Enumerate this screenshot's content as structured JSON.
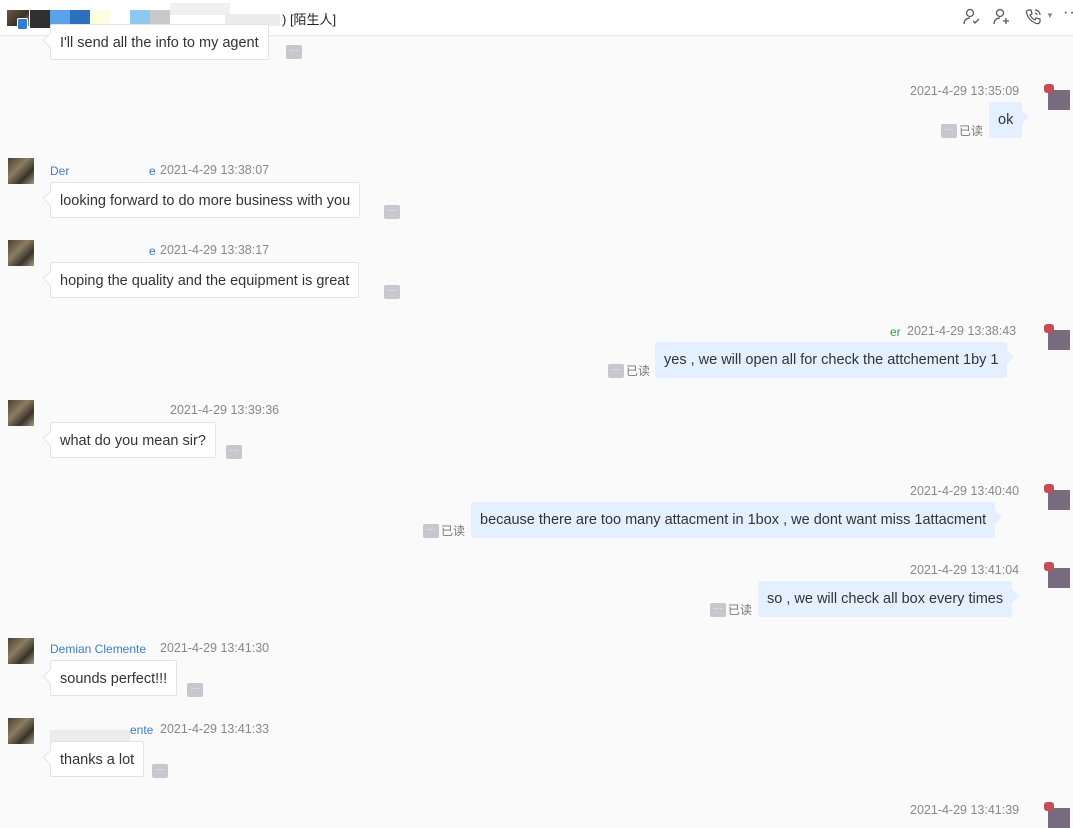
{
  "window": {
    "title": ") [陌生人]",
    "icons": [
      "add-contact-icon",
      "add-member-icon",
      "phone-call-icon",
      "more-icon"
    ],
    "more_label": "··"
  },
  "read_status_label": "已读",
  "dots_label": "···",
  "messages": [
    {
      "direction": "in",
      "text": "I'll send all the info to my agent"
    },
    {
      "direction": "out",
      "timestamp": "2021-4-29 13:35:09",
      "text": "ok",
      "read": "已读"
    },
    {
      "direction": "in",
      "name_fragment": "Der",
      "name_suffix": "e",
      "timestamp": "2021-4-29 13:38:07",
      "text": "looking forward to do more business with you"
    },
    {
      "direction": "in",
      "name_suffix": "e",
      "timestamp": "2021-4-29 13:38:17",
      "text": "hoping the quality and the equipment is great"
    },
    {
      "direction": "out",
      "name_fragment": "er",
      "timestamp": "2021-4-29 13:38:43",
      "text": "yes , we will open all for check the attchement 1by 1",
      "read": "已读"
    },
    {
      "direction": "in",
      "timestamp": "2021-4-29 13:39:36",
      "text": "what do you mean sir?"
    },
    {
      "direction": "out",
      "timestamp": "2021-4-29 13:40:40",
      "text": "because there are too many attacment in 1box , we dont want miss 1attacment",
      "read": "已读"
    },
    {
      "direction": "out",
      "timestamp": "2021-4-29 13:41:04",
      "text": "so , we will check all box every times",
      "read": "已读"
    },
    {
      "direction": "in",
      "name_fragment": "Demian Clemente",
      "timestamp": "2021-4-29 13:41:30",
      "text": "sounds perfect!!!"
    },
    {
      "direction": "in",
      "name_fragment": "ente",
      "timestamp": "2021-4-29 13:41:33",
      "text": "thanks a lot"
    },
    {
      "direction": "out",
      "timestamp": "2021-4-29 13:41:39"
    }
  ]
}
